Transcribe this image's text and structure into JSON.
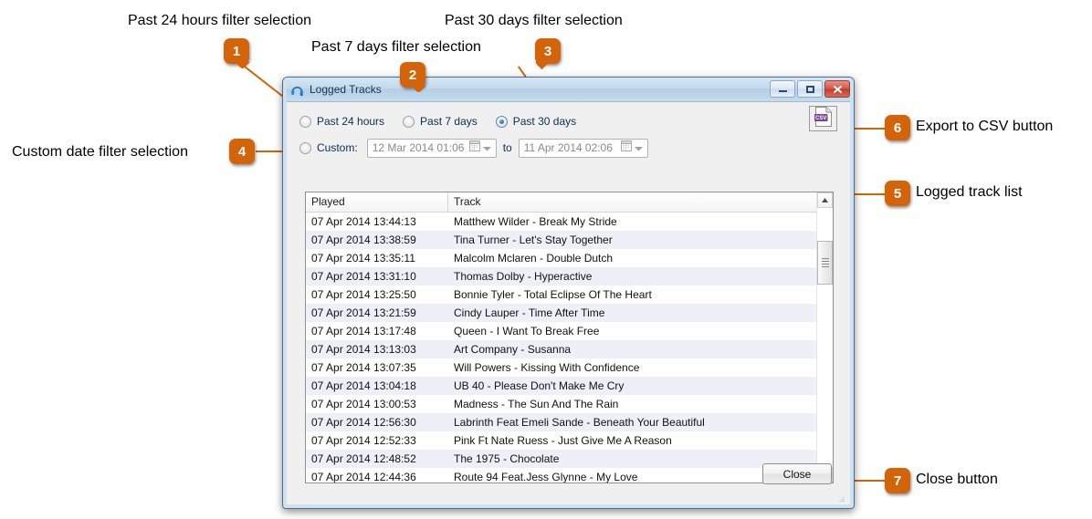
{
  "window": {
    "title": "Logged Tracks",
    "icon": "headphones-icon",
    "buttons": {
      "minimize": "minimize-icon",
      "maximize": "maximize-icon",
      "close": "close-icon"
    }
  },
  "filters": {
    "past24": {
      "label": "Past 24 hours",
      "selected": false
    },
    "past7": {
      "label": "Past 7 days",
      "selected": false
    },
    "past30": {
      "label": "Past 30 days",
      "selected": true
    },
    "custom": {
      "label": "Custom:",
      "selected": false
    },
    "from_date": "12 Mar 2014 01:06",
    "to_label": "to",
    "to_date": "11 Apr 2014 02:06",
    "export_icon": "csv-export-icon"
  },
  "list": {
    "columns": [
      "Played",
      "Track"
    ],
    "rows": [
      {
        "played": "07 Apr 2014 13:44:13",
        "track": "Matthew Wilder - Break My Stride"
      },
      {
        "played": "07 Apr 2014 13:38:59",
        "track": "Tina Turner - Let's Stay Together"
      },
      {
        "played": "07 Apr 2014 13:35:11",
        "track": "Malcolm Mclaren - Double Dutch"
      },
      {
        "played": "07 Apr 2014 13:31:10",
        "track": "Thomas Dolby - Hyperactive"
      },
      {
        "played": "07 Apr 2014 13:25:50",
        "track": "Bonnie Tyler - Total Eclipse Of The Heart"
      },
      {
        "played": "07 Apr 2014 13:21:59",
        "track": "Cindy Lauper - Time After Time"
      },
      {
        "played": "07 Apr 2014 13:17:48",
        "track": "Queen - I Want To Break Free"
      },
      {
        "played": "07 Apr 2014 13:13:03",
        "track": "Art Company - Susanna"
      },
      {
        "played": "07 Apr 2014 13:07:35",
        "track": "Will Powers - Kissing With Confidence"
      },
      {
        "played": "07 Apr 2014 13:04:18",
        "track": "UB 40 - Please Don't Make Me Cry"
      },
      {
        "played": "07 Apr 2014 13:00:53",
        "track": "Madness - The Sun And The Rain"
      },
      {
        "played": "07 Apr 2014 12:56:30",
        "track": "Labrinth Feat Emeli Sande - Beneath Your Beautiful"
      },
      {
        "played": "07 Apr 2014 12:52:33",
        "track": "Pink Ft Nate Ruess - Just Give Me A Reason"
      },
      {
        "played": "07 Apr 2014 12:48:52",
        "track": "The 1975 - Chocolate"
      },
      {
        "played": "07 Apr 2014 12:44:36",
        "track": "Route 94 Feat.Jess Glynne - My Love"
      }
    ]
  },
  "footer": {
    "close_label": "Close"
  },
  "annotations": {
    "a1": {
      "number": "1",
      "text": "Past 24 hours filter selection"
    },
    "a2": {
      "number": "2",
      "text": "Past 7 days filter selection"
    },
    "a3": {
      "number": "3",
      "text": "Past 30 days filter selection"
    },
    "a4": {
      "number": "4",
      "text": "Custom date filter selection"
    },
    "a5": {
      "number": "5",
      "text": "Logged track list"
    },
    "a6": {
      "number": "6",
      "text": "Export to CSV button"
    },
    "a7": {
      "number": "7",
      "text": "Close button"
    }
  },
  "colors": {
    "accent": "#D4640A",
    "title_bar": "#c3d9ec",
    "row_alt": "#eef0f8",
    "radio_selected": "#1f6fb5"
  }
}
